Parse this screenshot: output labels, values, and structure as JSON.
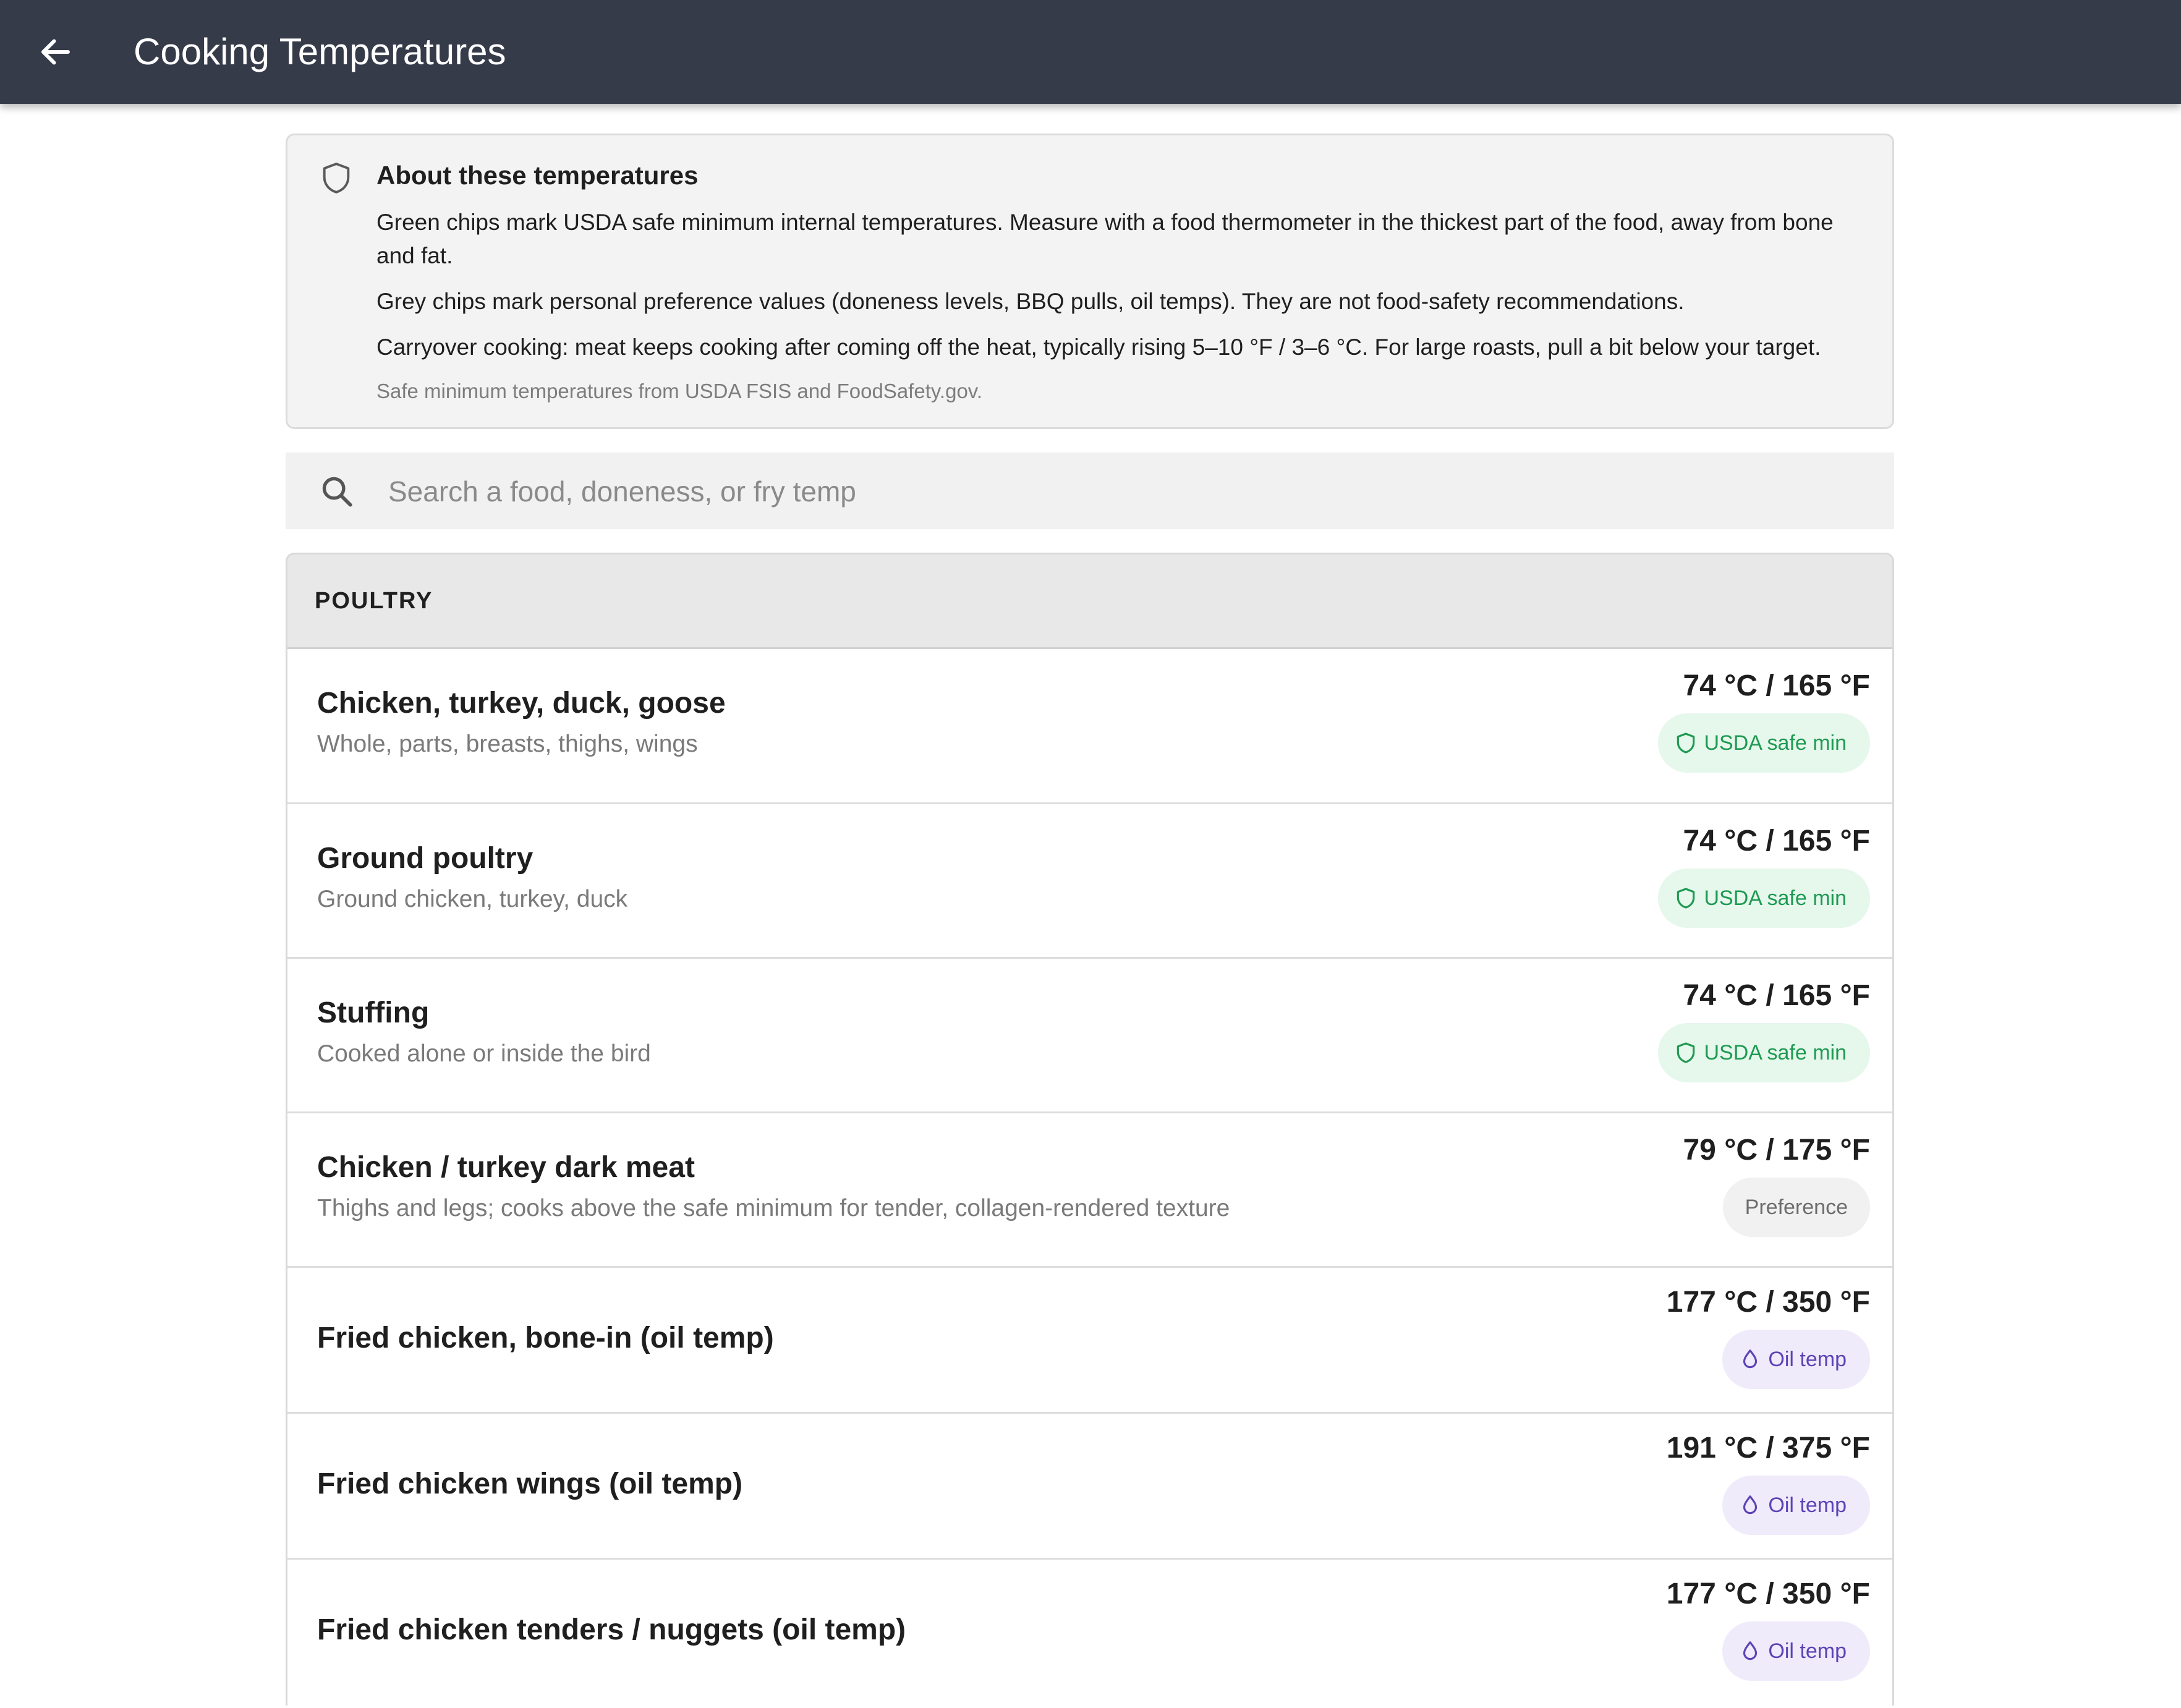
{
  "appbar": {
    "title": "Cooking Temperatures"
  },
  "info": {
    "title": "About these temperatures",
    "paragraphs": [
      "Green chips mark USDA safe minimum internal temperatures. Measure with a food thermometer in the thickest part of the food, away from bone and fat.",
      "Grey chips mark personal preference values (doneness levels, BBQ pulls, oil temps). They are not food-safety recommendations.",
      "Carryover cooking: meat keeps cooking after coming off the heat, typically rising 5–10 °F / 3–6 °C. For large roasts, pull a bit below your target."
    ],
    "source": "Safe minimum temperatures from USDA FSIS and FoodSafety.gov."
  },
  "search": {
    "placeholder": "Search a food, doneness, or fry temp",
    "value": ""
  },
  "section": {
    "title": "POULTRY",
    "items": [
      {
        "name": "Chicken, turkey, duck, goose",
        "sub": "Whole, parts, breasts, thighs, wings",
        "temp": "74 °C / 165 °F",
        "chip": "USDA safe min",
        "chip_type": "usda"
      },
      {
        "name": "Ground poultry",
        "sub": "Ground chicken, turkey, duck",
        "temp": "74 °C / 165 °F",
        "chip": "USDA safe min",
        "chip_type": "usda"
      },
      {
        "name": "Stuffing",
        "sub": "Cooked alone or inside the bird",
        "temp": "74 °C / 165 °F",
        "chip": "USDA safe min",
        "chip_type": "usda"
      },
      {
        "name": "Chicken / turkey dark meat",
        "sub": "Thighs and legs; cooks above the safe minimum for tender, collagen-rendered texture",
        "temp": "79 °C / 175 °F",
        "chip": "Preference",
        "chip_type": "pref"
      },
      {
        "name": "Fried chicken, bone-in (oil temp)",
        "sub": "",
        "temp": "177 °C / 350 °F",
        "chip": "Oil temp",
        "chip_type": "oil"
      },
      {
        "name": "Fried chicken wings (oil temp)",
        "sub": "",
        "temp": "191 °C / 375 °F",
        "chip": "Oil temp",
        "chip_type": "oil"
      },
      {
        "name": "Fried chicken tenders / nuggets (oil temp)",
        "sub": "",
        "temp": "177 °C / 350 °F",
        "chip": "Oil temp",
        "chip_type": "oil"
      }
    ]
  },
  "colors": {
    "appbar": "#363b4a",
    "usda": "#1e9a52",
    "oil": "#5d43b6",
    "pref": "#6d6d6d"
  },
  "icons": {
    "back": "arrow-left-icon",
    "info": "shield-icon",
    "search": "search-icon",
    "usda": "shield-icon",
    "oil": "drop-icon"
  }
}
